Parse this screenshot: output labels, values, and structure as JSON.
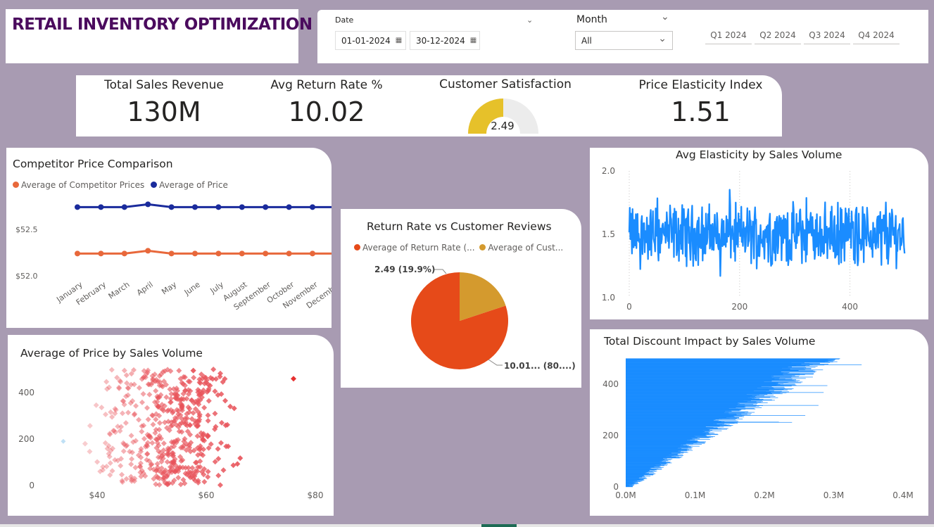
{
  "header": {
    "title": "RETAIL INVENTORY OPTIMIZATION"
  },
  "filters": {
    "date_label": "Date",
    "date_start": "01-01-2024",
    "date_end": "30-12-2024",
    "month_label": "Month",
    "month_value": "All",
    "quarters": [
      "Q1 2024",
      "Q2 2024",
      "Q3 2024",
      "Q4 2024"
    ]
  },
  "kpis": {
    "total_sales_label": "Total Sales Revenue",
    "total_sales_value": "130M",
    "return_rate_label": "Avg Return Rate %",
    "return_rate_value": "10.02",
    "satisfaction_label": "Customer Satisfaction",
    "satisfaction_value": "2.49",
    "elasticity_label": "Price Elasticity Index",
    "elasticity_value": "1.51"
  },
  "colors": {
    "accent_purple": "#4b0b5e",
    "orange": "#e8683b",
    "navy": "#1a2b9c",
    "gauge": "#e6c12a",
    "blue": "#1a8cff",
    "pie_orange": "#e64a19",
    "pie_gold": "#d49a2e",
    "scatter": "#e8535a"
  },
  "competitor_chart": {
    "title": "Competitor Price Comparison",
    "legend": [
      "Average of Competitor Prices",
      "Average of Price"
    ],
    "chart_data": {
      "type": "line",
      "categories": [
        "January",
        "February",
        "March",
        "April",
        "May",
        "June",
        "July",
        "August",
        "September",
        "October",
        "November",
        "December"
      ],
      "series": [
        {
          "name": "Average of Competitor Prices",
          "values": [
            52.24,
            52.24,
            52.24,
            52.27,
            52.24,
            52.24,
            52.24,
            52.24,
            52.24,
            52.24,
            52.24,
            52.24
          ]
        },
        {
          "name": "Average of Price",
          "values": [
            52.74,
            52.74,
            52.74,
            52.77,
            52.74,
            52.74,
            52.74,
            52.74,
            52.74,
            52.74,
            52.74,
            52.74
          ]
        }
      ],
      "y_ticks": [
        "$52.5",
        "$52.0"
      ]
    }
  },
  "return_pie": {
    "title": "Return Rate vs Customer Reviews",
    "legend": [
      "Average of Return Rate (...",
      "Average of Cust..."
    ],
    "chart_data": {
      "type": "pie",
      "slices": [
        {
          "name": "Average of Return Rate",
          "value": 10.01,
          "pct": 80.1
        },
        {
          "name": "Average of Customer Reviews",
          "value": 2.49,
          "pct": 19.9
        }
      ]
    },
    "label_small": "2.49 (19.9%)",
    "label_large": "10.01... (80....)"
  },
  "elasticity_chart": {
    "title": "Avg Elasticity by Sales Volume",
    "chart_data": {
      "type": "line",
      "x_ticks": [
        "0",
        "200",
        "400"
      ],
      "y_ticks": [
        "2.0",
        "1.5",
        "1.0"
      ],
      "xlim": [
        0,
        500
      ],
      "ylim": [
        1.0,
        2.0
      ]
    }
  },
  "scatter_chart": {
    "title": "Average of Price by Sales Volume",
    "chart_data": {
      "type": "scatter",
      "x_ticks": [
        "$40",
        "$60",
        "$80"
      ],
      "y_ticks": [
        "400",
        "200",
        "0"
      ],
      "xlim": [
        33,
        84
      ],
      "ylim": [
        0,
        500
      ]
    }
  },
  "discount_chart": {
    "title": "Total Discount Impact by Sales Volume",
    "chart_data": {
      "type": "bar",
      "x_ticks": [
        "0.0M",
        "0.1M",
        "0.2M",
        "0.3M",
        "0.4M"
      ],
      "y_ticks": [
        "400",
        "200",
        "0"
      ],
      "xlim": [
        0,
        0.4
      ],
      "ylim": [
        0,
        500
      ]
    }
  }
}
